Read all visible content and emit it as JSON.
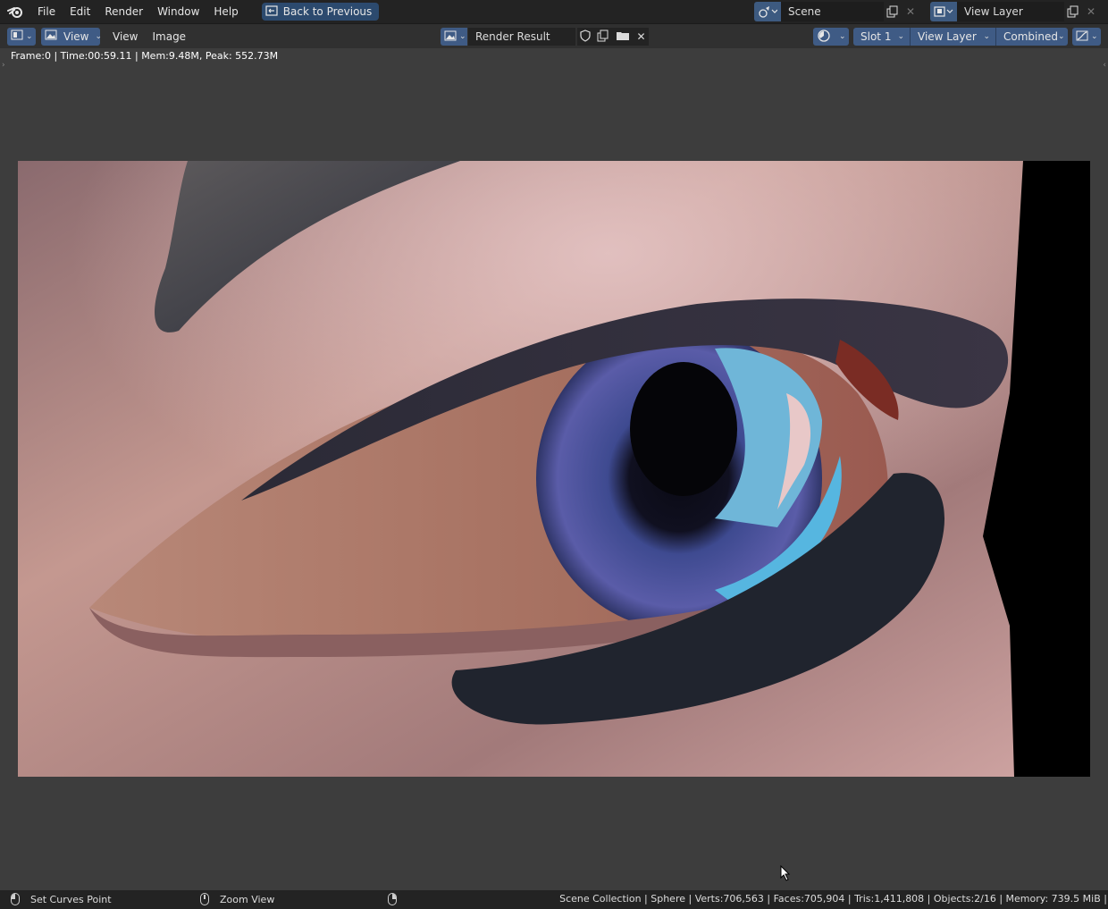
{
  "topbar": {
    "menus": [
      "File",
      "Edit",
      "Render",
      "Window",
      "Help"
    ],
    "back_label": "Back to Previous",
    "scene_name": "Scene",
    "view_layer_name": "View Layer"
  },
  "header": {
    "view_menu_btn": "View",
    "menus": [
      "View",
      "Image"
    ],
    "image_name": "Render Result",
    "slot": "Slot 1",
    "layer": "View Layer",
    "pass": "Combined"
  },
  "viewport": {
    "info": "Frame:0 | Time:00:59.11 | Mem:9.48M, Peak: 552.73M"
  },
  "statusbar": {
    "left_action": "Set Curves Point",
    "middle_action": "Zoom View",
    "stats": "Scene Collection | Sphere | Verts:706,563 | Faces:705,904 | Tris:1,411,808 | Objects:2/16 | Memory: 739.5 MiB | V"
  },
  "colors": {
    "accent": "#3f5b85",
    "topbar_bg": "#232323",
    "header_bg": "#303030",
    "viewport_bg": "#3d3d3d"
  }
}
